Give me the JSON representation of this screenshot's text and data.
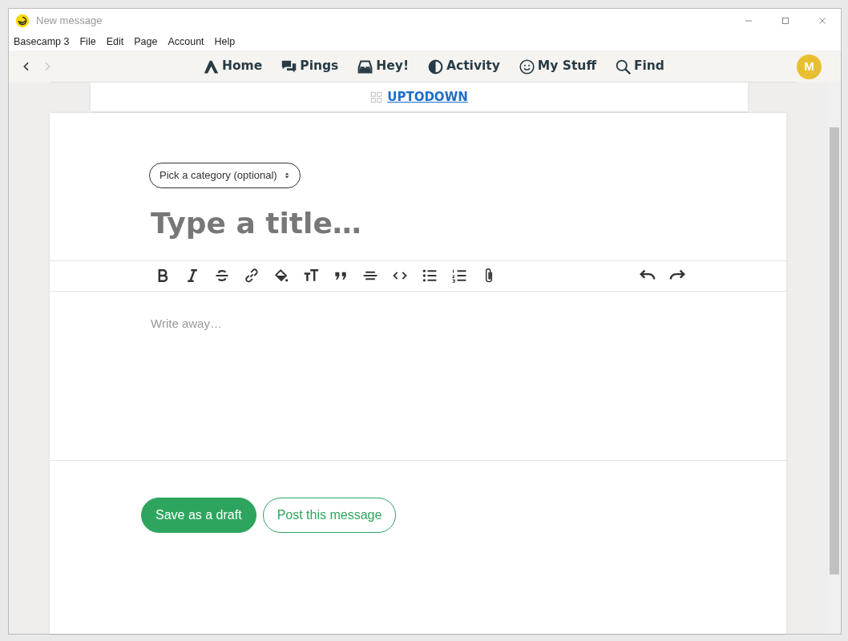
{
  "window": {
    "title": "New message"
  },
  "menu": [
    "Basecamp 3",
    "File",
    "Edit",
    "Page",
    "Account",
    "Help"
  ],
  "nav": {
    "back_disabled": false,
    "forward_disabled": true,
    "items": [
      {
        "label": "Home"
      },
      {
        "label": "Pings"
      },
      {
        "label": "Hey!"
      },
      {
        "label": "Activity"
      },
      {
        "label": "My Stuff"
      },
      {
        "label": "Find"
      }
    ],
    "avatar": "M"
  },
  "project": {
    "name": "UPTODOWN"
  },
  "form": {
    "category": "Pick a category (optional)",
    "title_placeholder": "Type a title…",
    "body_placeholder": "Write away…"
  },
  "buttons": [
    {
      "label": "Save as a draft",
      "kind": "primary"
    },
    {
      "label": "Post this message",
      "kind": "outline"
    }
  ]
}
